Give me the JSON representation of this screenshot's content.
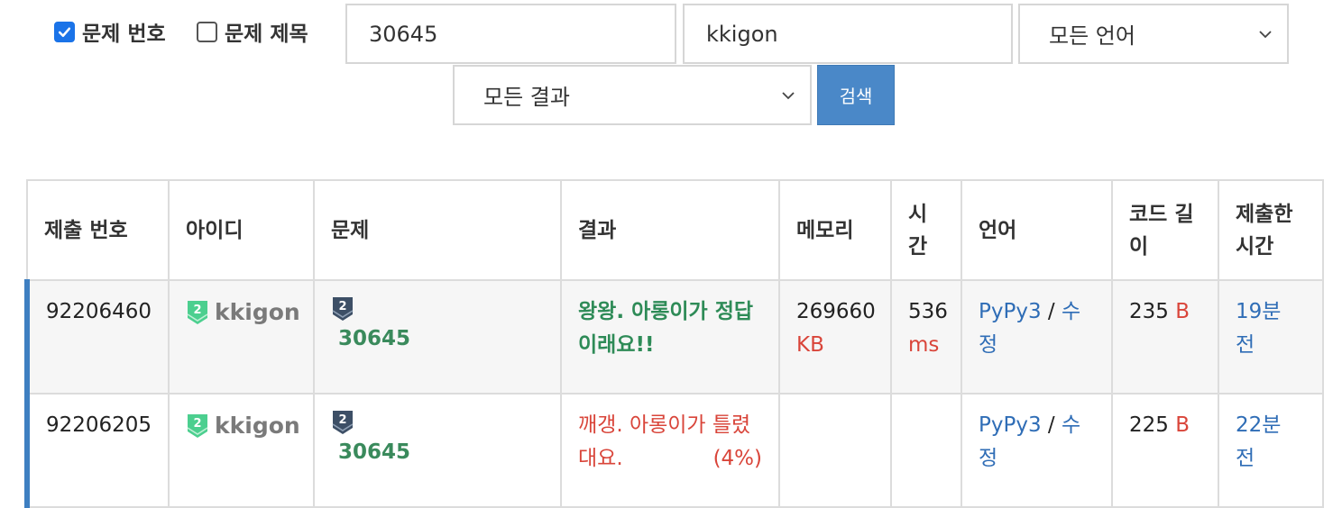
{
  "filters": {
    "problem_number_checkbox": {
      "label": "문제 번호",
      "checked": true
    },
    "problem_title_checkbox": {
      "label": "문제 제목",
      "checked": false
    },
    "problem_input": {
      "value": "30645"
    },
    "user_input": {
      "value": "kkigon"
    },
    "language_select": {
      "value": "모든 언어"
    },
    "result_select": {
      "value": "모든 결과"
    },
    "search_button": {
      "label": "검색"
    }
  },
  "table": {
    "headers": {
      "submission": "제출 번호",
      "user": "아이디",
      "problem": "문제",
      "result": "결과",
      "memory": "메모리",
      "time": "시간",
      "language": "언어",
      "code_length": "코드 길이",
      "submitted_at": "제출한 시간"
    },
    "rows": [
      {
        "submission_id": "92206460",
        "user_tier": "2",
        "user": "kkigon",
        "problem_tier": "2",
        "problem": "30645",
        "result": "왕왕. 아롱이가 정답이래요!!",
        "result_percent": "",
        "memory": "269660",
        "memory_unit": "KB",
        "time": "536",
        "time_unit": "ms",
        "language": "PyPy3",
        "separator": "/",
        "edit": "수정",
        "code_length": "235",
        "code_unit": "B",
        "submitted_at": "19분 전"
      },
      {
        "submission_id": "92206205",
        "user_tier": "2",
        "user": "kkigon",
        "problem_tier": "2",
        "problem": "30645",
        "result": "깨갱. 아롱이가 틀렸대요.",
        "result_percent": "(4%)",
        "memory": "",
        "memory_unit": "",
        "time": "",
        "time_unit": "",
        "language": "PyPy3",
        "separator": "/",
        "edit": "수정",
        "code_length": "225",
        "code_unit": "B",
        "submitted_at": "22분 전"
      }
    ]
  },
  "colors": {
    "accent_blue": "#4a88c8",
    "row_marker": "#3e7fc1",
    "accepted_green": "#2e8b57",
    "wrong_red": "#d9453a",
    "tier_green": "#4ccf8f",
    "problem_tier_slate": "#3d4f66"
  },
  "icons": {
    "checked_box": "checkbox-checked-icon",
    "unchecked_box": "checkbox-unchecked-icon",
    "chevron": "chevron-down-icon",
    "user_tier": "tier-badge-icon",
    "problem_tier": "problem-tier-badge-icon"
  }
}
